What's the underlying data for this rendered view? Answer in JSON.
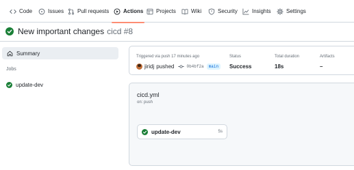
{
  "nav": {
    "tabs": [
      {
        "label": "Code",
        "icon": "code-icon"
      },
      {
        "label": "Issues",
        "icon": "issue-icon"
      },
      {
        "label": "Pull requests",
        "icon": "pull-request-icon"
      },
      {
        "label": "Actions",
        "icon": "play-icon",
        "active": true
      },
      {
        "label": "Projects",
        "icon": "table-icon"
      },
      {
        "label": "Wiki",
        "icon": "book-icon"
      },
      {
        "label": "Security",
        "icon": "shield-icon"
      },
      {
        "label": "Insights",
        "icon": "graph-icon"
      },
      {
        "label": "Settings",
        "icon": "gear-icon"
      }
    ],
    "active_underline_color": "#fd8c73"
  },
  "run": {
    "title": "New important changes",
    "subtitle": "cicd #8",
    "status_color": "#1a7f37"
  },
  "sidebar": {
    "summary_label": "Summary",
    "jobs_heading": "Jobs",
    "jobs": [
      {
        "label": "update-dev"
      }
    ]
  },
  "summary": {
    "trigger_label": "Triggered via push 17 minutes ago",
    "actor": "jiridj",
    "action": "pushed",
    "commit_sha": "0b4bf2a",
    "branch": "main",
    "status_label": "Status",
    "status_value": "Success",
    "duration_label": "Total duration",
    "duration_value": "18s",
    "artifacts_label": "Artifacts",
    "artifacts_value": "–"
  },
  "workflow": {
    "file": "cicd.yml",
    "trigger": "on: push",
    "job_name": "update-dev",
    "job_duration": "5s"
  }
}
